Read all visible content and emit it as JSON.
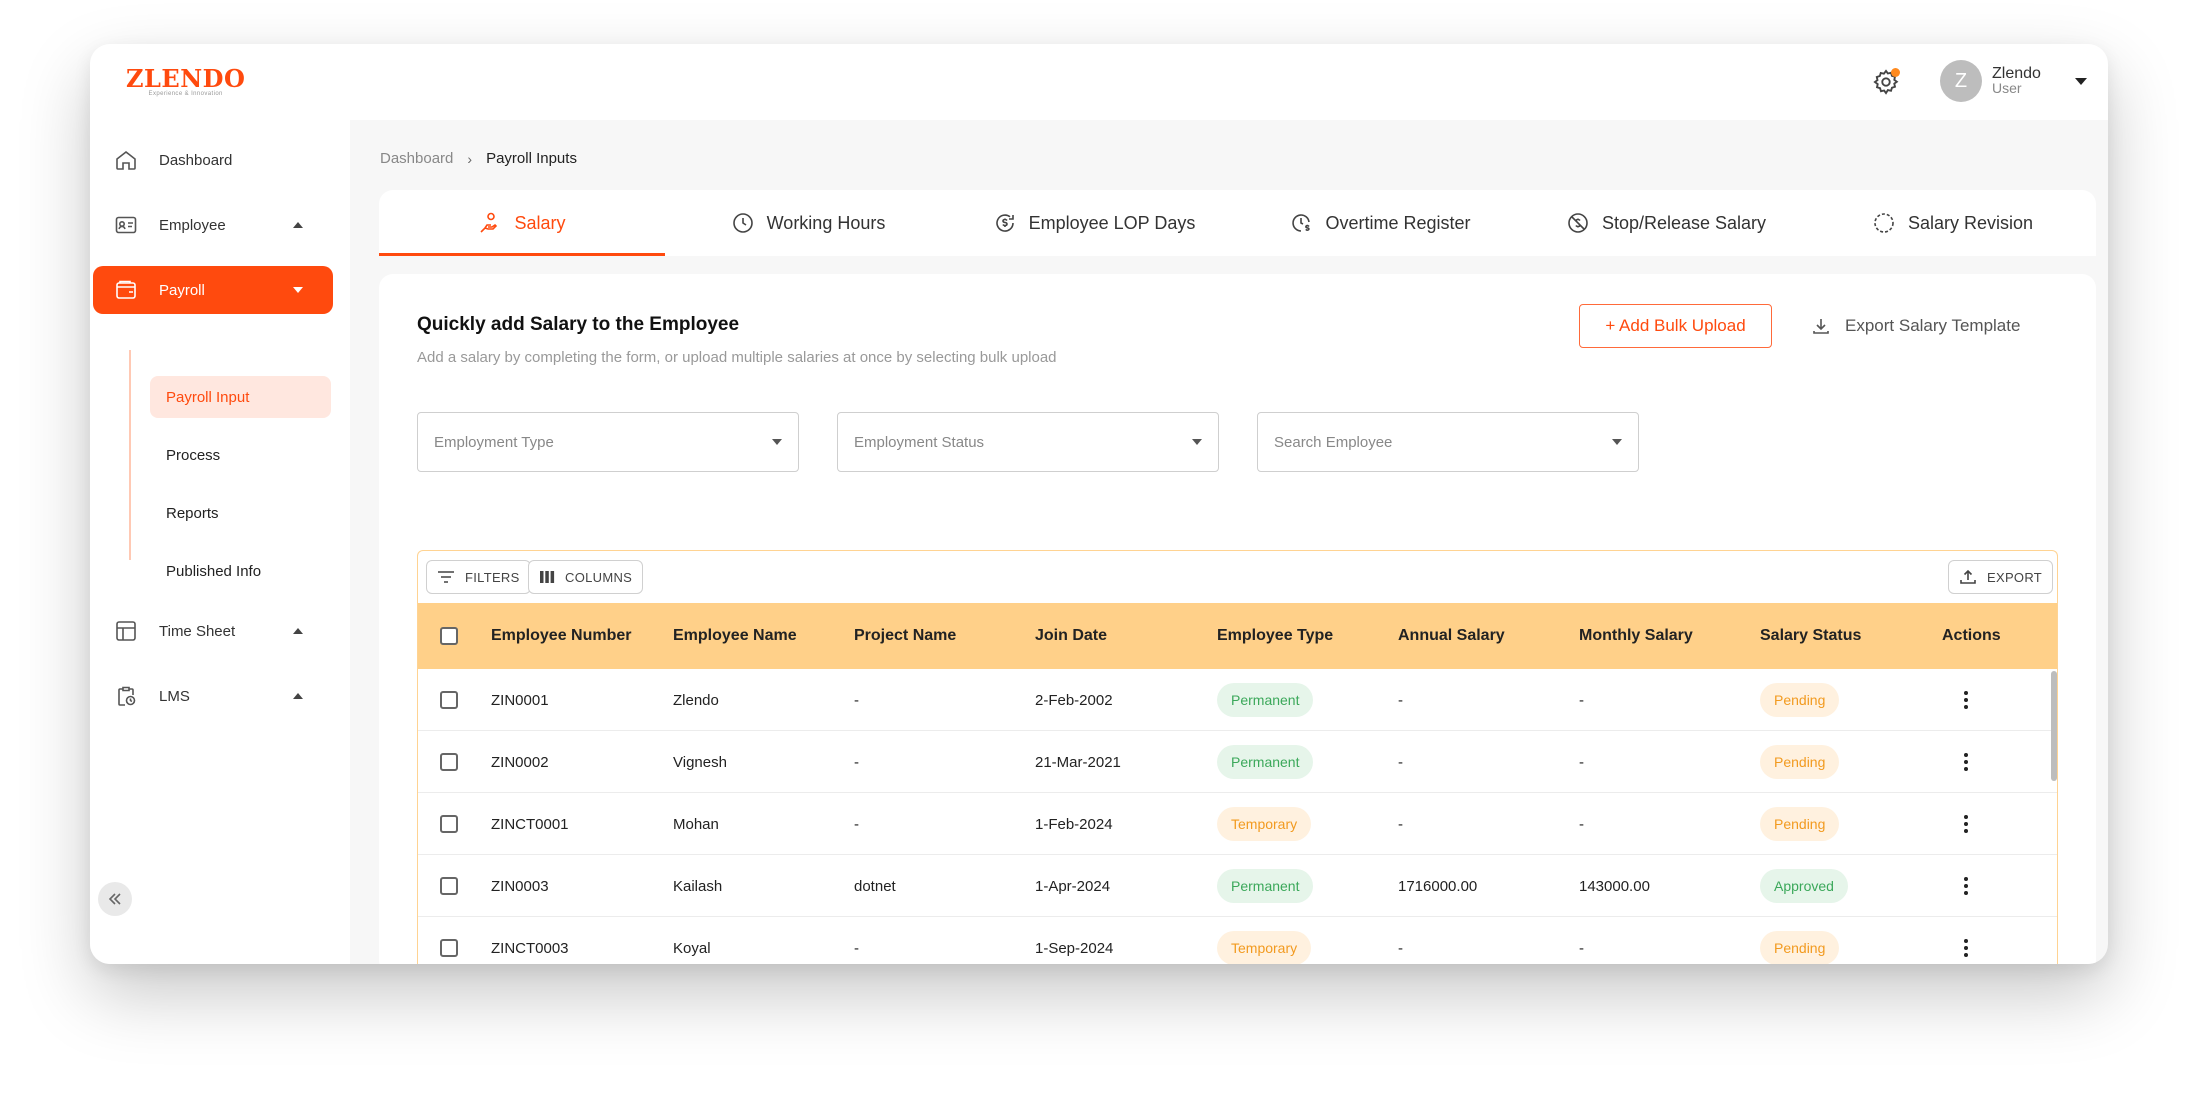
{
  "app": {
    "logo_text": "ZLENDO",
    "logo_tagline": "Experience & Innovation"
  },
  "header": {
    "user_initial": "Z",
    "user_name": "Zlendo",
    "user_role": "User",
    "notification_dot_color": "#ff8a1f"
  },
  "sidebar": {
    "items": [
      {
        "label": "Dashboard",
        "icon": "home-icon"
      },
      {
        "label": "Employee",
        "icon": "id-card-icon"
      },
      {
        "label": "Payroll",
        "icon": "wallet-icon"
      },
      {
        "label": "Time Sheet",
        "icon": "table-icon"
      },
      {
        "label": "LMS",
        "icon": "clipboard-clock-icon"
      }
    ],
    "payroll_sub": [
      "Payroll Input",
      "Process",
      "Reports",
      "Published Info"
    ]
  },
  "breadcrumb": {
    "home": "Dashboard",
    "current": "Payroll Inputs"
  },
  "tabs": [
    {
      "label": "Salary",
      "icon": "hand-coin-icon"
    },
    {
      "label": "Working Hours",
      "icon": "clock-icon"
    },
    {
      "label": "Employee LOP Days",
      "icon": "dollar-refresh-icon"
    },
    {
      "label": "Overtime Register",
      "icon": "clock-dollar-icon"
    },
    {
      "label": "Stop/Release Salary",
      "icon": "no-dollar-icon"
    },
    {
      "label": "Salary Revision",
      "icon": "dollar-cycle-icon"
    }
  ],
  "card": {
    "title": "Quickly add Salary to the Employee",
    "subtitle": "Add a salary by completing the form, or upload multiple salaries at once by selecting bulk upload",
    "bulk_upload": "+ Add Bulk Upload",
    "export_template": "Export Salary Template"
  },
  "filters": {
    "employment_type": "Employment Type",
    "employment_status": "Employment Status",
    "search_employee": "Search Employee"
  },
  "toolbar": {
    "filters": "FILTERS",
    "columns": "COLUMNS",
    "export": "EXPORT"
  },
  "table": {
    "columns": [
      "Employee Number",
      "Employee Name",
      "Project Name",
      "Join Date",
      "Employee Type",
      "Annual Salary",
      "Monthly Salary",
      "Salary Status",
      "Actions"
    ],
    "rows": [
      {
        "number": "ZIN0001",
        "name": "Zlendo",
        "project": "-",
        "join": "2-Feb-2002",
        "type": "Permanent",
        "annual": "-",
        "monthly": "-",
        "status": "Pending"
      },
      {
        "number": "ZIN0002",
        "name": "Vignesh",
        "project": "-",
        "join": "21-Mar-2021",
        "type": "Permanent",
        "annual": "-",
        "monthly": "-",
        "status": "Pending"
      },
      {
        "number": "ZINCT0001",
        "name": "Mohan",
        "project": "-",
        "join": "1-Feb-2024",
        "type": "Temporary",
        "annual": "-",
        "monthly": "-",
        "status": "Pending"
      },
      {
        "number": "ZIN0003",
        "name": "Kailash",
        "project": "dotnet",
        "join": "1-Apr-2024",
        "type": "Permanent",
        "annual": "1716000.00",
        "monthly": "143000.00",
        "status": "Approved"
      },
      {
        "number": "ZINCT0003",
        "name": "Koyal",
        "project": "-",
        "join": "1-Sep-2024",
        "type": "Temporary",
        "annual": "-",
        "monthly": "-",
        "status": "Pending"
      }
    ]
  },
  "colors": {
    "accent": "#ff4a0e",
    "table_header": "#ffd089",
    "chip_green_bg": "#e6f5ea",
    "chip_green_text": "#3ba85a",
    "chip_orange_bg": "#fff1df",
    "chip_orange_text": "#f29a1f"
  }
}
